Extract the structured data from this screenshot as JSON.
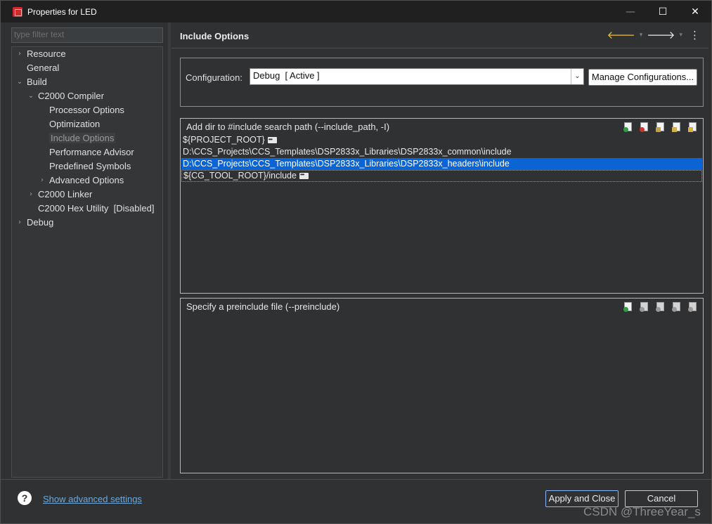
{
  "window": {
    "title": "Properties for LED",
    "controls": {
      "minimize": "—",
      "maximize": "☐",
      "close": "✕"
    }
  },
  "sidebar": {
    "filter_placeholder": "type filter text",
    "items": [
      {
        "label": "Resource",
        "chevron": "›"
      },
      {
        "label": "General",
        "chevron": ""
      },
      {
        "label": "Build",
        "chevron": "⌄"
      },
      {
        "label": "C2000 Compiler",
        "chevron": "⌄"
      },
      {
        "label": "Processor Options",
        "chevron": ""
      },
      {
        "label": "Optimization",
        "chevron": ""
      },
      {
        "label": "Include Options",
        "chevron": "",
        "selected": true
      },
      {
        "label": "Performance Advisor",
        "chevron": ""
      },
      {
        "label": "Predefined Symbols",
        "chevron": ""
      },
      {
        "label": "Advanced Options",
        "chevron": "›"
      },
      {
        "label": "C2000 Linker",
        "chevron": "›"
      },
      {
        "label": "C2000 Hex Utility  [Disabled]",
        "chevron": ""
      },
      {
        "label": "Debug",
        "chevron": "›"
      }
    ]
  },
  "main": {
    "title": "Include Options",
    "configuration": {
      "label": "Configuration:",
      "value": "Debug  [ Active ]",
      "manage_label": "Manage Configurations..."
    },
    "include_path": {
      "header": "Add dir to #include search path (--include_path, -I)",
      "rows": [
        "${PROJECT_ROOT}",
        "D:\\CCS_Projects\\CCS_Templates\\DSP2833x_Libraries\\DSP2833x_common\\include",
        "D:\\CCS_Projects\\CCS_Templates\\DSP2833x_Libraries\\DSP2833x_headers\\include",
        "${CG_TOOL_ROOT}/include"
      ]
    },
    "preinclude": {
      "header": "Specify a preinclude file (--preinclude)"
    }
  },
  "footer": {
    "help_icon": "?",
    "advanced_link": "Show advanced settings",
    "apply_label": "Apply and Close",
    "cancel_label": "Cancel"
  },
  "watermark": "CSDN @ThreeYear_s",
  "colors": {
    "selection": "#0a64d4",
    "link": "#6fa8dc",
    "nav_back": "#f0c030"
  }
}
